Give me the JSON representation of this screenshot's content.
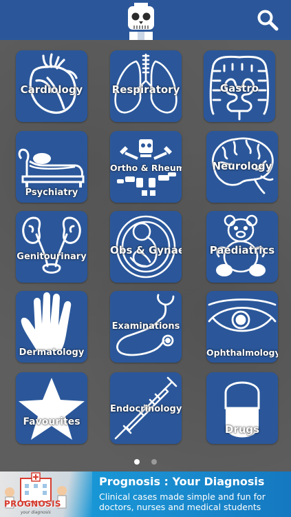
{
  "header": {
    "logo_icon": "skeleton-head-icon",
    "search_icon": "search-icon"
  },
  "tiles": [
    {
      "label": "Cardiology",
      "icon": "heart-icon"
    },
    {
      "label": "Respiratory",
      "icon": "lungs-icon"
    },
    {
      "label": "Gastro",
      "icon": "intestine-icon"
    },
    {
      "label": "Psychiatry",
      "icon": "couch-icon"
    },
    {
      "label": "Ortho & Rheum",
      "icon": "skeleton-icon"
    },
    {
      "label": "Neurology",
      "icon": "brain-icon"
    },
    {
      "label": "Genitourinary",
      "icon": "kidneys-icon"
    },
    {
      "label": "Obs & Gynae",
      "icon": "fetus-icon"
    },
    {
      "label": "Paediatrics",
      "icon": "teddy-bear-icon"
    },
    {
      "label": "Dermatology",
      "icon": "hand-icon"
    },
    {
      "label": "Examinations",
      "icon": "stethoscope-icon"
    },
    {
      "label": "Ophthalmology",
      "icon": "eye-icon"
    },
    {
      "label": "Favourites",
      "icon": "star-icon"
    },
    {
      "label": "Endocrinology",
      "icon": "syringe-icon"
    },
    {
      "label": "Drugs",
      "icon": "capsule-icon"
    }
  ],
  "pager": {
    "pages": 2,
    "current": 1
  },
  "banner": {
    "title": "Prognosis : Your Diagnosis",
    "subtitle": "Clinical cases made simple and fun for doctors, nurses and medical students",
    "brand": "PROGNOSIS",
    "brand_tagline": "your diagnosis"
  },
  "colors": {
    "tile_blue": "#2b579a",
    "background_gray": "#5e5e5e",
    "banner_blue": "#16a0dc",
    "dot_active": "#ffffff",
    "dot_inactive": "#9a9a9a"
  }
}
